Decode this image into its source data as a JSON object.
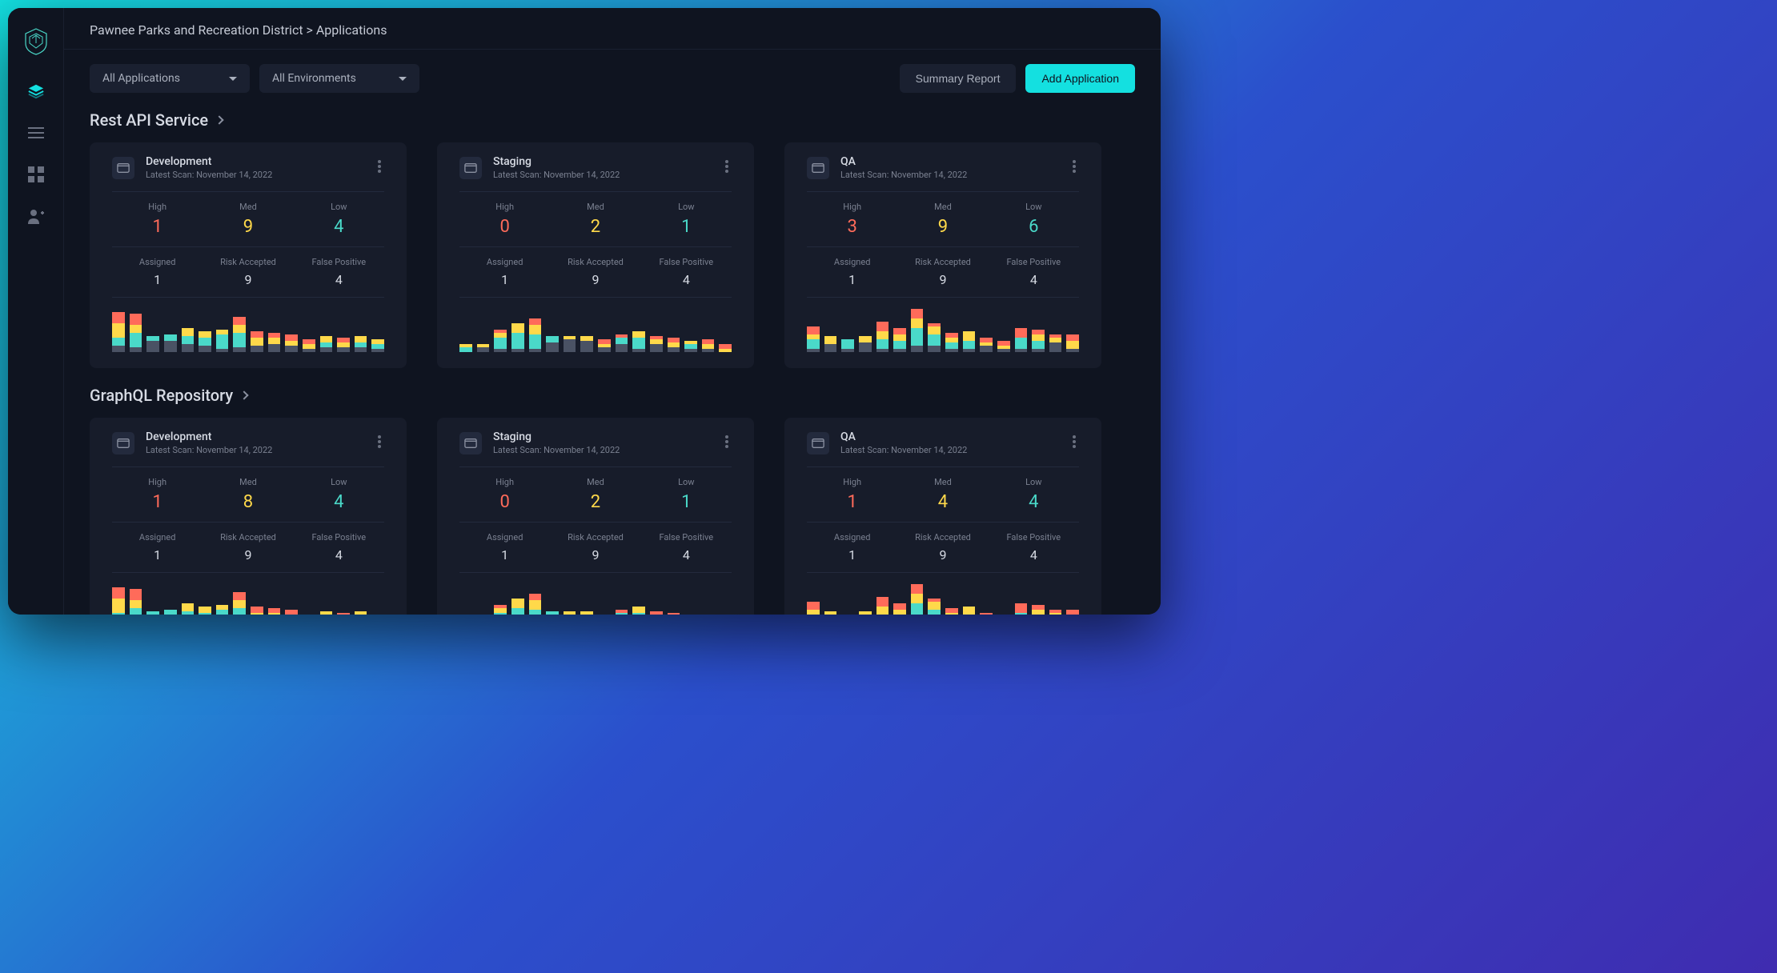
{
  "breadcrumb": "Pawnee Parks and Recreation District > Applications",
  "filters": {
    "applications": "All Applications",
    "environments": "All Environments"
  },
  "buttons": {
    "summary_report": "Summary Report",
    "add_application": "Add Application"
  },
  "labels": {
    "high": "High",
    "med": "Med",
    "low": "Low",
    "assigned": "Assigned",
    "risk_accepted": "Risk Accepted",
    "false_positive": "False Positive",
    "latest_scan_prefix": "Latest Scan: "
  },
  "colors": {
    "high": "#ff6b5a",
    "med": "#ffd94a",
    "low": "#4ad9c9",
    "accent": "#14e0e0"
  },
  "sections": [
    {
      "title": "Rest API Service",
      "cards": [
        {
          "env": "Development",
          "latest_scan": "November 14, 2022",
          "severity": {
            "high": "1",
            "med": "9",
            "low": "4"
          },
          "status": {
            "assigned": "1",
            "risk_accepted": "9",
            "false_positive": "4"
          }
        },
        {
          "env": "Staging",
          "latest_scan": "November 14, 2022",
          "severity": {
            "high": "0",
            "med": "2",
            "low": "1"
          },
          "status": {
            "assigned": "1",
            "risk_accepted": "9",
            "false_positive": "4"
          }
        },
        {
          "env": "QA",
          "latest_scan": "November 14, 2022",
          "severity": {
            "high": "3",
            "med": "9",
            "low": "6"
          },
          "status": {
            "assigned": "1",
            "risk_accepted": "9",
            "false_positive": "4"
          }
        }
      ]
    },
    {
      "title": "GraphQL Repository",
      "cards": [
        {
          "env": "Development",
          "latest_scan": "November 14, 2022",
          "severity": {
            "high": "1",
            "med": "8",
            "low": "4"
          },
          "status": {
            "assigned": "1",
            "risk_accepted": "9",
            "false_positive": "4"
          }
        },
        {
          "env": "Staging",
          "latest_scan": "November 14, 2022",
          "severity": {
            "high": "0",
            "med": "2",
            "low": "1"
          },
          "status": {
            "assigned": "1",
            "risk_accepted": "9",
            "false_positive": "4"
          }
        },
        {
          "env": "QA",
          "latest_scan": "November 14, 2022",
          "severity": {
            "high": "1",
            "med": "4",
            "low": "4"
          },
          "status": {
            "assigned": "1",
            "risk_accepted": "9",
            "false_positive": "4"
          }
        }
      ]
    }
  ],
  "chart_data": {
    "type": "bar",
    "note": "Stacked mini bar charts per environment card. 16 bars each, segments bottom-to-top = gray/teal/yellow/red. Values are pixel heights (relative).",
    "series_colors": {
      "gray": "#4a5264",
      "teal": "#4ad9c9",
      "yellow": "#ffd94a",
      "red": "#ff6b5a"
    },
    "cards": {
      "rest_api_development": [
        [
          8,
          10,
          18,
          14
        ],
        [
          6,
          18,
          10,
          14
        ],
        [
          14,
          6,
          0,
          0
        ],
        [
          14,
          8,
          0,
          0
        ],
        [
          10,
          10,
          10,
          0
        ],
        [
          8,
          10,
          8,
          0
        ],
        [
          4,
          18,
          6,
          0
        ],
        [
          6,
          18,
          10,
          10
        ],
        [
          8,
          0,
          10,
          8
        ],
        [
          10,
          0,
          8,
          6
        ],
        [
          8,
          0,
          6,
          8
        ],
        [
          4,
          0,
          6,
          6
        ],
        [
          6,
          6,
          8,
          0
        ],
        [
          6,
          0,
          6,
          6
        ],
        [
          6,
          6,
          8,
          0
        ],
        [
          4,
          6,
          6,
          0
        ]
      ],
      "rest_api_staging": [
        [
          0,
          6,
          4,
          0
        ],
        [
          6,
          0,
          4,
          0
        ],
        [
          4,
          14,
          6,
          4
        ],
        [
          4,
          20,
          12,
          0
        ],
        [
          4,
          18,
          12,
          8
        ],
        [
          12,
          8,
          0,
          0
        ],
        [
          16,
          0,
          4,
          0
        ],
        [
          14,
          0,
          6,
          0
        ],
        [
          6,
          0,
          4,
          6
        ],
        [
          10,
          8,
          0,
          4
        ],
        [
          4,
          14,
          8,
          0
        ],
        [
          10,
          0,
          6,
          4
        ],
        [
          6,
          0,
          6,
          6
        ],
        [
          4,
          6,
          4,
          0
        ],
        [
          4,
          0,
          6,
          6
        ],
        [
          0,
          0,
          4,
          6
        ]
      ],
      "rest_api_qa": [
        [
          4,
          12,
          6,
          10
        ],
        [
          10,
          0,
          10,
          0
        ],
        [
          4,
          12,
          0,
          0
        ],
        [
          12,
          0,
          8,
          0
        ],
        [
          4,
          12,
          10,
          12
        ],
        [
          4,
          10,
          8,
          8
        ],
        [
          8,
          22,
          12,
          12
        ],
        [
          8,
          14,
          10,
          4
        ],
        [
          4,
          8,
          6,
          6
        ],
        [
          4,
          10,
          12,
          0
        ],
        [
          8,
          0,
          4,
          6
        ],
        [
          4,
          0,
          4,
          6
        ],
        [
          4,
          14,
          0,
          12
        ],
        [
          4,
          10,
          8,
          6
        ],
        [
          12,
          0,
          6,
          4
        ],
        [
          4,
          0,
          10,
          8
        ]
      ],
      "graphql_development": [
        [
          8,
          10,
          18,
          14
        ],
        [
          6,
          18,
          10,
          14
        ],
        [
          14,
          6,
          0,
          0
        ],
        [
          14,
          8,
          0,
          0
        ],
        [
          10,
          10,
          10,
          0
        ],
        [
          8,
          10,
          8,
          0
        ],
        [
          4,
          18,
          6,
          0
        ],
        [
          6,
          18,
          10,
          10
        ],
        [
          8,
          0,
          10,
          8
        ],
        [
          10,
          0,
          8,
          6
        ],
        [
          8,
          0,
          6,
          8
        ],
        [
          4,
          0,
          6,
          6
        ],
        [
          6,
          6,
          8,
          0
        ],
        [
          6,
          0,
          6,
          6
        ],
        [
          6,
          6,
          8,
          0
        ],
        [
          4,
          6,
          6,
          0
        ]
      ],
      "graphql_staging": [
        [
          0,
          6,
          4,
          0
        ],
        [
          6,
          0,
          4,
          0
        ],
        [
          4,
          14,
          6,
          4
        ],
        [
          4,
          20,
          12,
          0
        ],
        [
          4,
          18,
          12,
          8
        ],
        [
          12,
          8,
          0,
          0
        ],
        [
          16,
          0,
          4,
          0
        ],
        [
          14,
          0,
          6,
          0
        ],
        [
          6,
          0,
          4,
          6
        ],
        [
          10,
          8,
          0,
          4
        ],
        [
          4,
          14,
          8,
          0
        ],
        [
          10,
          0,
          6,
          4
        ],
        [
          6,
          0,
          6,
          6
        ],
        [
          4,
          6,
          4,
          0
        ],
        [
          4,
          0,
          6,
          6
        ],
        [
          0,
          0,
          4,
          6
        ]
      ],
      "graphql_qa": [
        [
          4,
          12,
          6,
          10
        ],
        [
          10,
          0,
          10,
          0
        ],
        [
          4,
          12,
          0,
          0
        ],
        [
          12,
          0,
          8,
          0
        ],
        [
          4,
          12,
          10,
          12
        ],
        [
          4,
          10,
          8,
          8
        ],
        [
          8,
          22,
          12,
          12
        ],
        [
          8,
          14,
          10,
          4
        ],
        [
          4,
          8,
          6,
          6
        ],
        [
          4,
          10,
          12,
          0
        ],
        [
          8,
          0,
          4,
          6
        ],
        [
          4,
          0,
          4,
          6
        ],
        [
          4,
          14,
          0,
          12
        ],
        [
          4,
          10,
          8,
          6
        ],
        [
          12,
          0,
          6,
          4
        ],
        [
          4,
          0,
          10,
          8
        ]
      ]
    }
  }
}
